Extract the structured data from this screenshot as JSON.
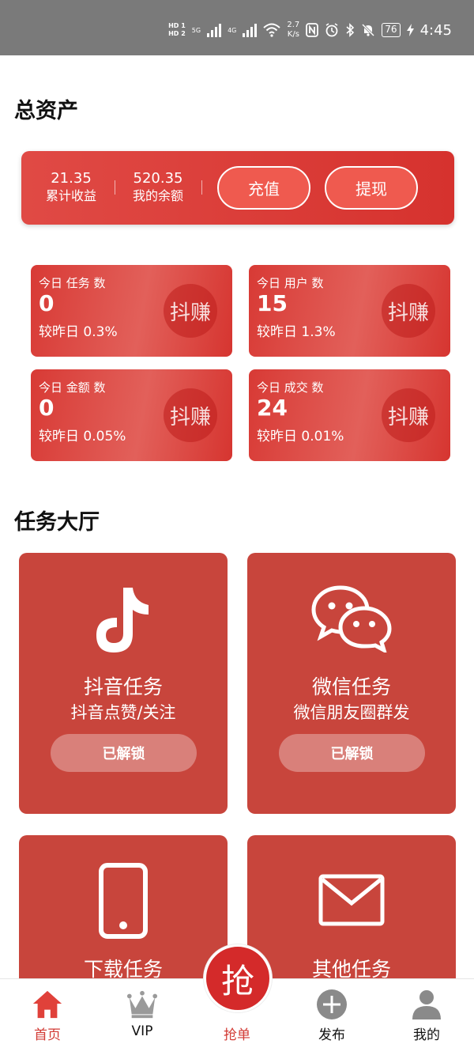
{
  "status_bar": {
    "hd1": "HD 1",
    "hd2": "HD 2",
    "net1": "5G",
    "net2": "4G",
    "speed_value": "2.7",
    "speed_unit": "K/s",
    "battery": "76",
    "time": "4:45"
  },
  "assets": {
    "title": "总资产",
    "cumulative_value": "21.35",
    "cumulative_label": "累计收益",
    "balance_value": "520.35",
    "balance_label": "我的余额",
    "recharge_label": "充值",
    "withdraw_label": "提现"
  },
  "stats": [
    {
      "title": "今日 任务 数",
      "value": "0",
      "compare": "较昨日 0.3%",
      "badge": "抖赚"
    },
    {
      "title": "今日 用户 数",
      "value": "15",
      "compare": "较昨日 1.3%",
      "badge": "抖赚"
    },
    {
      "title": "今日 金额 数",
      "value": "0",
      "compare": "较昨日 0.05%",
      "badge": "抖赚"
    },
    {
      "title": "今日 成交 数",
      "value": "24",
      "compare": "较昨日 0.01%",
      "badge": "抖赚"
    }
  ],
  "task_hall": {
    "title": "任务大厅",
    "tasks": [
      {
        "name": "抖音任务",
        "desc": "抖音点赞/关注",
        "status": "已解锁",
        "icon": "tiktok-icon"
      },
      {
        "name": "微信任务",
        "desc": "微信朋友圈群发",
        "status": "已解锁",
        "icon": "wechat-icon"
      },
      {
        "name": "下载任务",
        "icon": "phone-icon"
      },
      {
        "name": "其他任务",
        "icon": "mail-icon"
      }
    ]
  },
  "nav": {
    "home": "首页",
    "vip": "VIP",
    "grab_center": "抢",
    "grab": "抢单",
    "publish": "发布",
    "mine": "我的"
  },
  "colors": {
    "primary_red": "#d6322e",
    "task_card": "#c8453c",
    "status_bar": "#7a7a7a"
  }
}
